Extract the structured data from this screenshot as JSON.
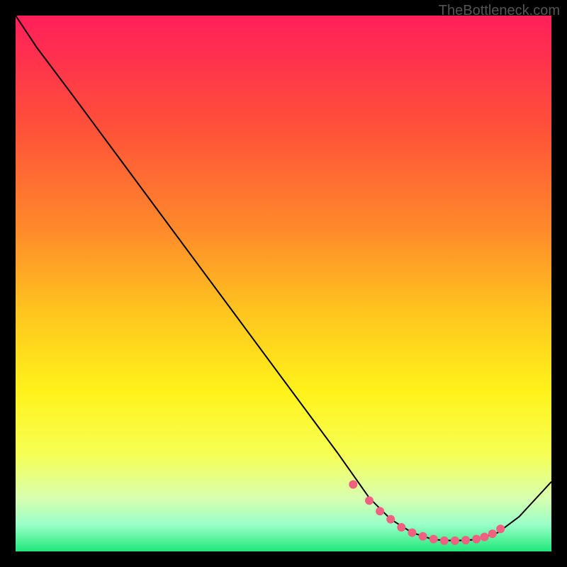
{
  "watermark": "TheBottleneck.com",
  "chart_data": {
    "type": "line",
    "title": "",
    "xlabel": "",
    "ylabel": "",
    "xlim": [
      0,
      100
    ],
    "ylim": [
      0,
      100
    ],
    "grid": false,
    "legend": false,
    "series": [
      {
        "name": "curve",
        "x": [
          0,
          4,
          10,
          20,
          30,
          40,
          50,
          60,
          66,
          70,
          74,
          78,
          82,
          86,
          90,
          94,
          100
        ],
        "y": [
          100,
          94,
          86,
          72.5,
          59,
          45.5,
          32,
          18.5,
          10,
          6,
          3.5,
          2.2,
          2.0,
          2.2,
          3.5,
          6.5,
          13
        ]
      }
    ],
    "markers": {
      "name": "highlight-zone",
      "color": "#f06080",
      "x": [
        63,
        66,
        68,
        70,
        72,
        74,
        76,
        78,
        80,
        82,
        84,
        86,
        87.5,
        89,
        90.5
      ],
      "y": [
        12.5,
        9.5,
        7.5,
        6.0,
        4.5,
        3.5,
        2.8,
        2.3,
        2.0,
        2.0,
        2.1,
        2.3,
        2.7,
        3.3,
        4.2
      ]
    },
    "background_gradient": {
      "stops": [
        {
          "pos": 0.0,
          "color": "#ff1f5a"
        },
        {
          "pos": 0.2,
          "color": "#ff4e3a"
        },
        {
          "pos": 0.4,
          "color": "#ff8a2a"
        },
        {
          "pos": 0.55,
          "color": "#ffc41f"
        },
        {
          "pos": 0.7,
          "color": "#fff21a"
        },
        {
          "pos": 0.82,
          "color": "#f6ff55"
        },
        {
          "pos": 0.9,
          "color": "#d8ffb0"
        },
        {
          "pos": 0.95,
          "color": "#9affc8"
        },
        {
          "pos": 1.0,
          "color": "#1fe87a"
        }
      ]
    }
  }
}
